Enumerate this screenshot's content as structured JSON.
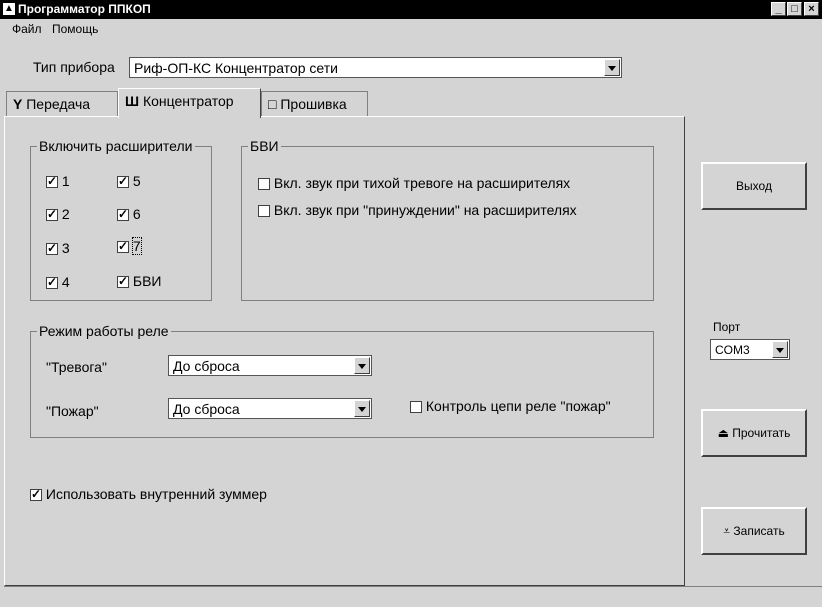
{
  "window": {
    "title": "Программатор ППКОП",
    "minimize": "_",
    "maximize": "□",
    "close": "×"
  },
  "menu": {
    "file": "Файл",
    "help": "Помощь"
  },
  "device": {
    "label": "Тип прибора",
    "value": "Риф-ОП-КС Концентратор сети"
  },
  "tabs": [
    {
      "icon": "Y",
      "label": "Передача"
    },
    {
      "icon": "Ш",
      "label": "Концентратор"
    },
    {
      "icon": "□",
      "label": "Прошивка"
    }
  ],
  "expanders": {
    "title": "Включить расширители",
    "items": [
      {
        "label": "1",
        "checked": true
      },
      {
        "label": "2",
        "checked": true
      },
      {
        "label": "3",
        "checked": true
      },
      {
        "label": "4",
        "checked": true
      },
      {
        "label": "5",
        "checked": true
      },
      {
        "label": "6",
        "checked": true
      },
      {
        "label": "7",
        "checked": true
      },
      {
        "label": "БВИ",
        "checked": true
      }
    ]
  },
  "bvi": {
    "title": "БВИ",
    "opt1": "Вкл. звук при тихой тревоге на расширителях",
    "opt2": "Вкл. звук при \"принуждении\" на расширителях"
  },
  "relay": {
    "title": "Режим работы реле",
    "alarm_label": "\"Тревога\"",
    "alarm_value": "До сброса",
    "fire_label": "\"Пожар\"",
    "fire_value": "До сброса",
    "control_label": "Контроль цепи реле \"пожар\""
  },
  "buzzer": {
    "label": "Использовать внутренний зуммер",
    "checked": true
  },
  "buttons": {
    "exit": "Выход",
    "read": "Прочитать",
    "write": "Записать"
  },
  "port": {
    "label": "Порт",
    "value": "COM3"
  }
}
